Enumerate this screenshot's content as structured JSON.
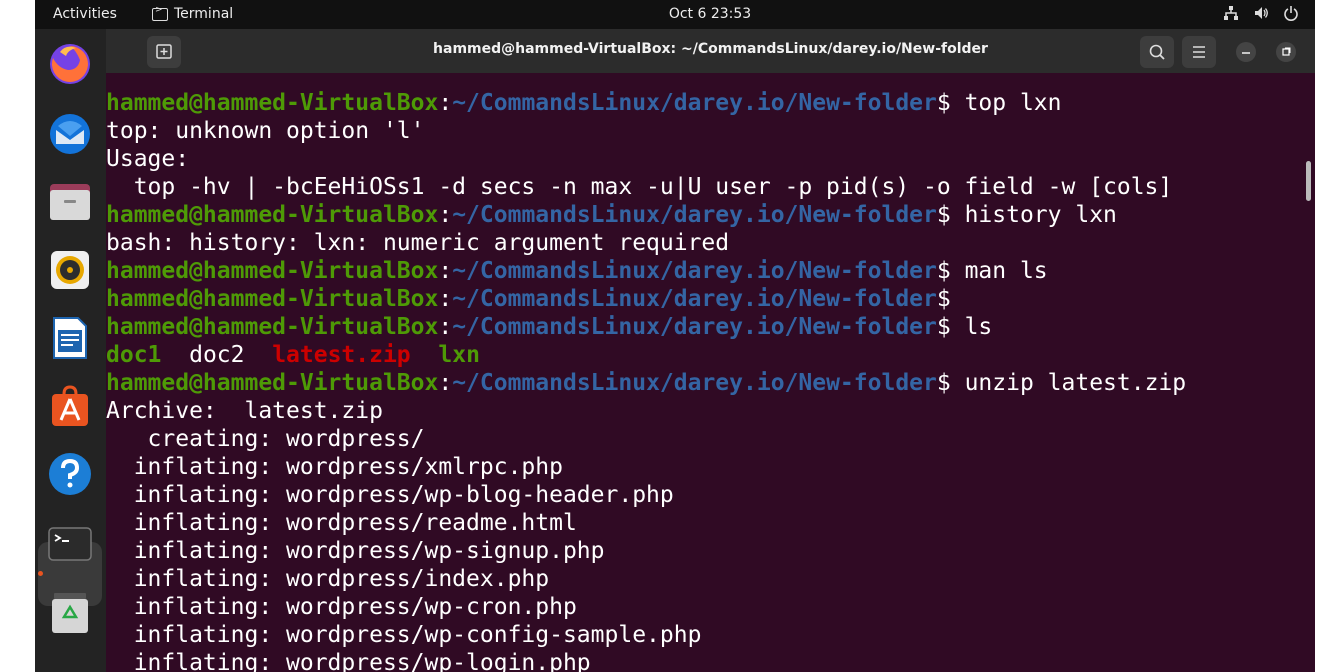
{
  "topbar": {
    "activities": "Activities",
    "app_name": "Terminal",
    "clock": "Oct 6  23:53"
  },
  "window": {
    "title": "hammed@hammed-VirtualBox: ~/CommandsLinux/darey.io/New-folder"
  },
  "prompt": {
    "user": "hammed@hammed-VirtualBox",
    "path": "~/CommandsLinux/darey.io/New-folder",
    "symbol": "$"
  },
  "terminal": {
    "lines": [
      {
        "type": "prompt",
        "cmd": " top lxn"
      },
      {
        "type": "text",
        "text": "top: unknown option 'l'"
      },
      {
        "type": "text",
        "text": "Usage:"
      },
      {
        "type": "text",
        "text": "  top -hv | -bcEeHiOSs1 -d secs -n max -u|U user -p pid(s) -o field -w [cols]"
      },
      {
        "type": "prompt",
        "cmd": " history lxn"
      },
      {
        "type": "text",
        "text": "bash: history: lxn: numeric argument required"
      },
      {
        "type": "prompt",
        "cmd": " man ls"
      },
      {
        "type": "prompt",
        "cmd": ""
      },
      {
        "type": "prompt",
        "cmd": " ls"
      },
      {
        "type": "ls",
        "items": [
          {
            "name": "doc1",
            "color": "g",
            "sep": "  "
          },
          {
            "name": "doc2",
            "color": "n",
            "sep": "  "
          },
          {
            "name": "latest.zip",
            "color": "r",
            "sep": "  "
          },
          {
            "name": "lxn",
            "color": "g",
            "sep": ""
          }
        ]
      },
      {
        "type": "prompt",
        "cmd": " unzip latest.zip"
      },
      {
        "type": "text",
        "text": "Archive:  latest.zip"
      },
      {
        "type": "text",
        "text": "   creating: wordpress/"
      },
      {
        "type": "text",
        "text": "  inflating: wordpress/xmlrpc.php"
      },
      {
        "type": "text",
        "text": "  inflating: wordpress/wp-blog-header.php"
      },
      {
        "type": "text",
        "text": "  inflating: wordpress/readme.html"
      },
      {
        "type": "text",
        "text": "  inflating: wordpress/wp-signup.php"
      },
      {
        "type": "text",
        "text": "  inflating: wordpress/index.php"
      },
      {
        "type": "text",
        "text": "  inflating: wordpress/wp-cron.php"
      },
      {
        "type": "text",
        "text": "  inflating: wordpress/wp-config-sample.php"
      },
      {
        "type": "text",
        "text": "  inflating: wordpress/wp-login.php"
      }
    ]
  },
  "dock": {
    "items": [
      "firefox-icon",
      "thunderbird-icon",
      "files-icon",
      "rhythmbox-icon",
      "writer-icon",
      "app-center-icon",
      "help-icon",
      "terminal-icon",
      "trash-icon"
    ]
  },
  "colors": {
    "terminal_bg": "#300a24",
    "user_green": "#4e9a06",
    "path_blue": "#3465a4",
    "zip_red": "#cc0000"
  }
}
